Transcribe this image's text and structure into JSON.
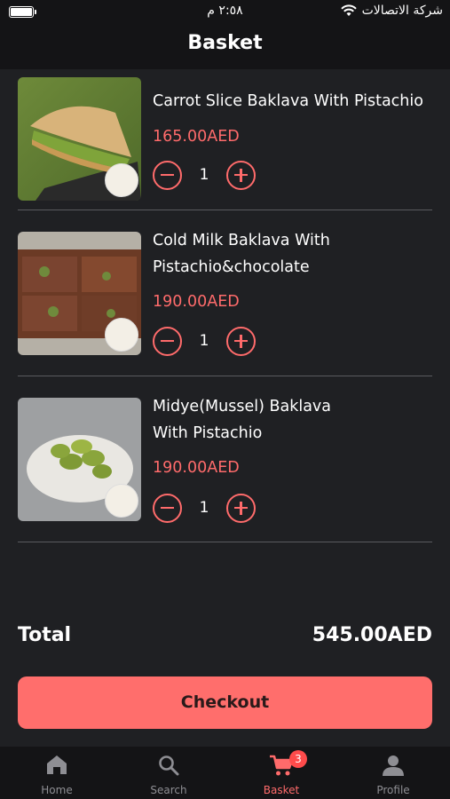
{
  "status_bar": {
    "time": "٢:٥٨ م",
    "carrier": "شركة الاتصالات"
  },
  "header": {
    "title": "Basket"
  },
  "items": [
    {
      "title_line1": "Carrot Slice Baklava With Pistachio",
      "title_line2": "",
      "price": "165.00AED",
      "quantity": "1"
    },
    {
      "title_line1": "Cold Milk Baklava With",
      "title_line2": "Pistachio&chocolate",
      "price": "190.00AED",
      "quantity": "1"
    },
    {
      "title_line1": "Midye(Mussel) Baklava",
      "title_line2": "With Pistachio",
      "price": "190.00AED",
      "quantity": "1"
    }
  ],
  "summary": {
    "total_label": "Total",
    "total_value": "545.00AED"
  },
  "checkout": {
    "label": "Checkout"
  },
  "tabbar": {
    "tabs": [
      {
        "label": "Home",
        "icon": "home-icon"
      },
      {
        "label": "Search",
        "icon": "search-icon"
      },
      {
        "label": "Basket",
        "icon": "cart-icon",
        "badge": "3"
      },
      {
        "label": "Profile",
        "icon": "profile-icon"
      }
    ]
  },
  "colors": {
    "accent": "#ff6b6b",
    "background": "#1f2023",
    "bar": "#141416"
  }
}
